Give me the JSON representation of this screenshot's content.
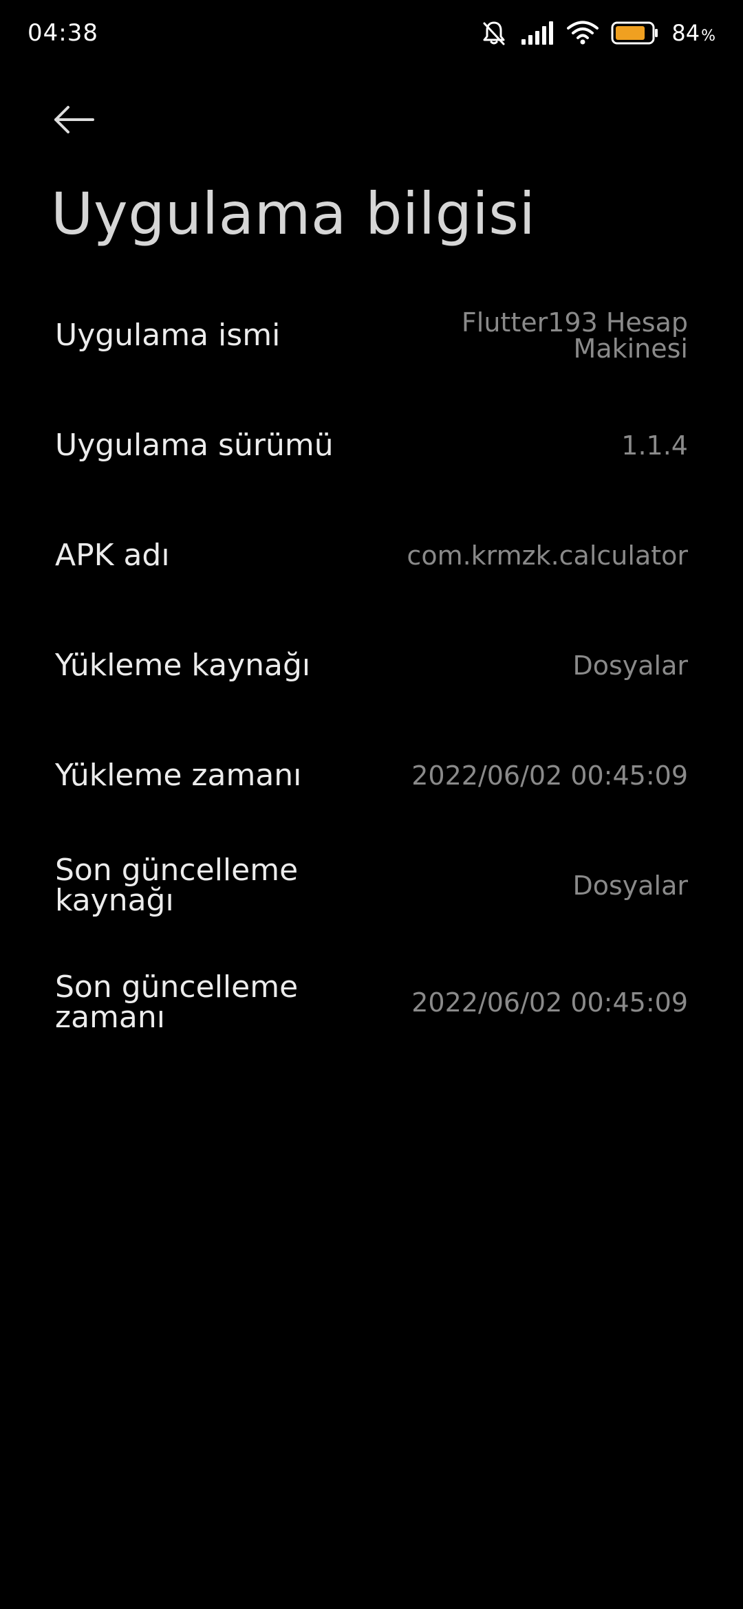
{
  "status_bar": {
    "time": "04:38",
    "battery_percent": "84",
    "battery_unit": "%",
    "battery_level": 0.84,
    "battery_color": "#f0a020",
    "icons": [
      "bell-off-icon",
      "signal-icon",
      "wifi-icon",
      "battery-icon"
    ]
  },
  "header": {
    "back_icon": "arrow-left-icon",
    "title": "Uygulama bilgisi"
  },
  "info": {
    "rows": [
      {
        "label": "Uygulama ismi",
        "value": "Flutter193 Hesap Makinesi"
      },
      {
        "label": "Uygulama sürümü",
        "value": "1.1.4"
      },
      {
        "label": "APK adı",
        "value": "com.krmzk.calculator"
      },
      {
        "label": "Yükleme kaynağı",
        "value": "Dosyalar"
      },
      {
        "label": "Yükleme zamanı",
        "value": "2022/06/02 00:45:09"
      },
      {
        "label": "Son güncelleme kaynağı",
        "value": "Dosyalar"
      },
      {
        "label": "Son güncelleme zamanı",
        "value": "2022/06/02 00:45:09"
      }
    ]
  },
  "colors": {
    "background": "#000000",
    "label": "#ececec",
    "value": "#8a8a8a",
    "title": "#d6d6d6"
  }
}
